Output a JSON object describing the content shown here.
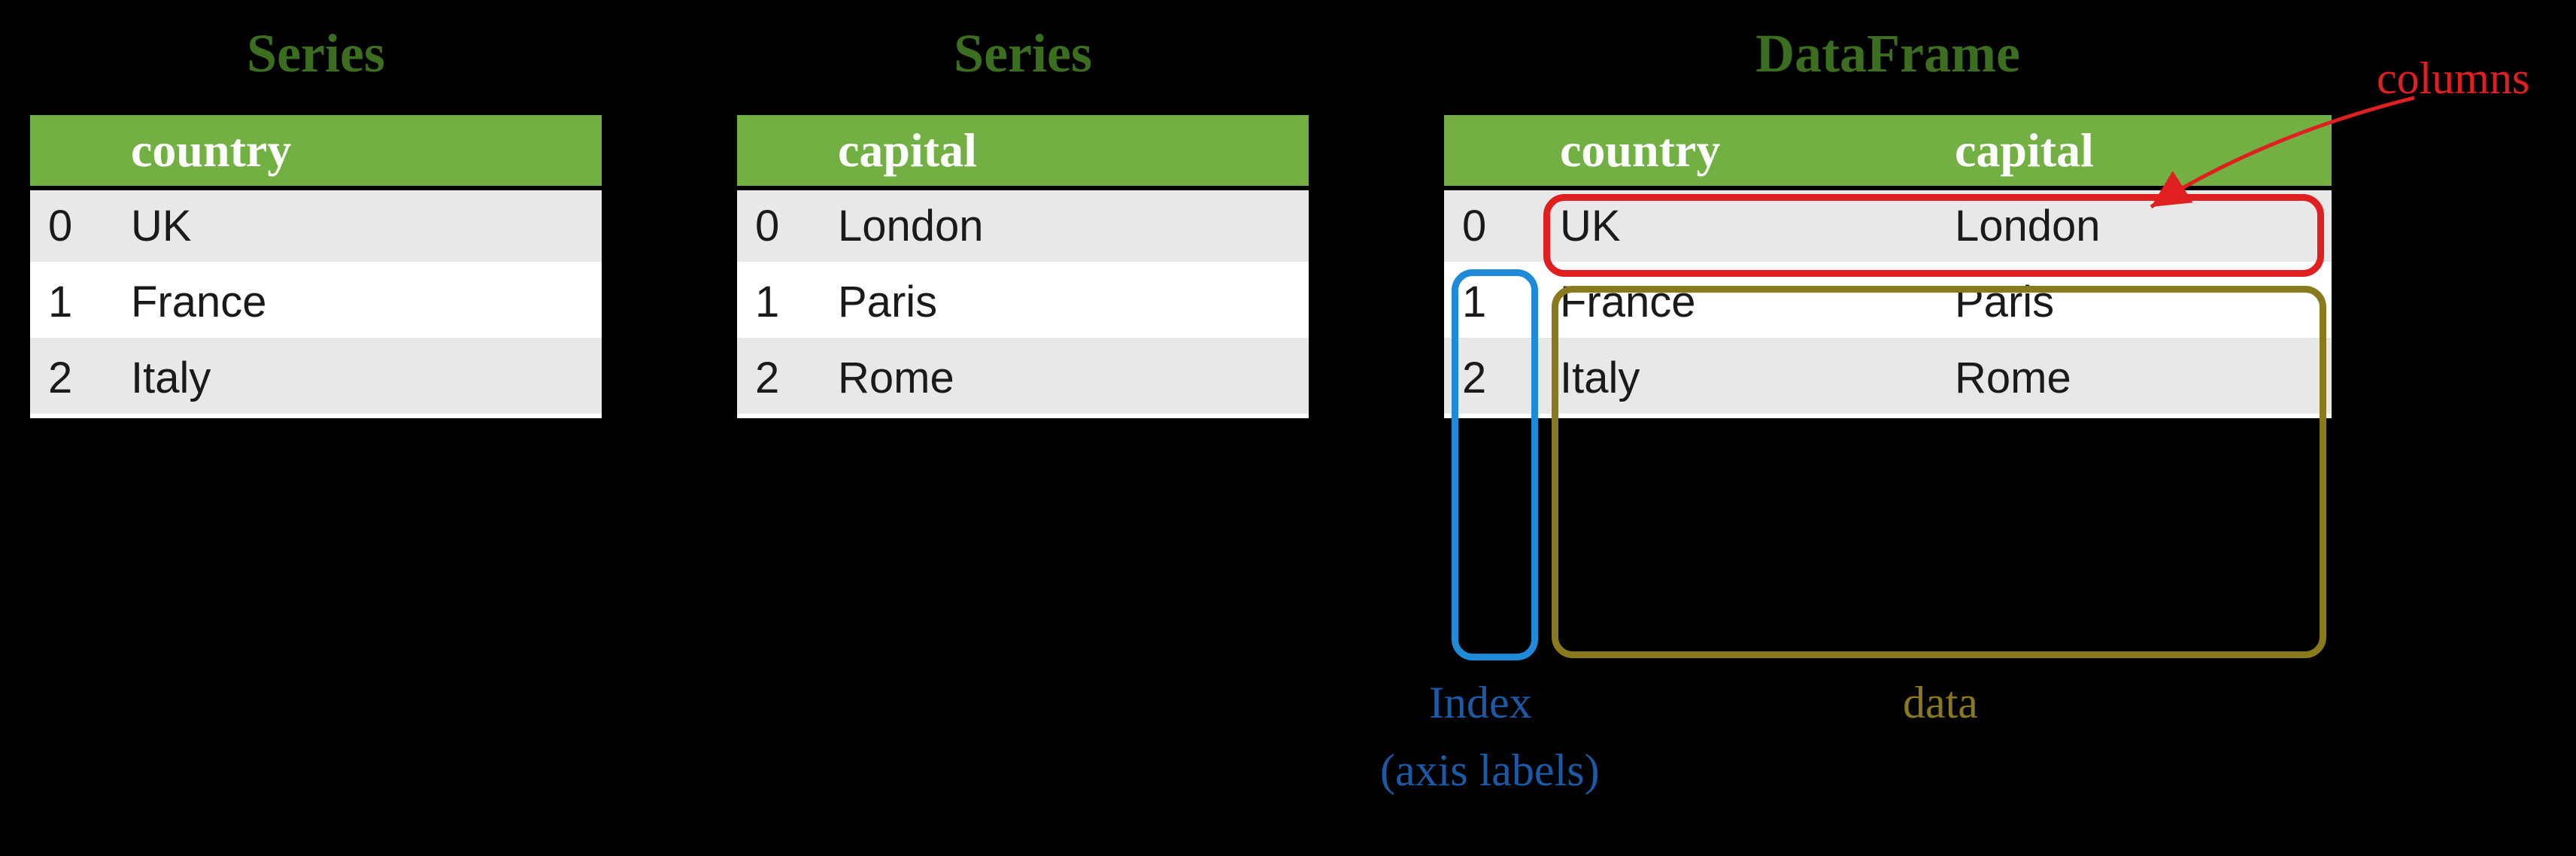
{
  "series1": {
    "title": "Series",
    "header": "country",
    "rows": [
      {
        "index": "0",
        "value": "UK"
      },
      {
        "index": "1",
        "value": "France"
      },
      {
        "index": "2",
        "value": "Italy"
      }
    ]
  },
  "series2": {
    "title": "Series",
    "header": "capital",
    "rows": [
      {
        "index": "0",
        "value": "London"
      },
      {
        "index": "1",
        "value": "Paris"
      },
      {
        "index": "2",
        "value": "Rome"
      }
    ]
  },
  "dataframe": {
    "title": "DataFrame",
    "headers": [
      "country",
      "capital"
    ],
    "rows": [
      {
        "index": "0",
        "cells": [
          "UK",
          "London"
        ]
      },
      {
        "index": "1",
        "cells": [
          "France",
          "Paris"
        ]
      },
      {
        "index": "2",
        "cells": [
          "Italy",
          "Rome"
        ]
      }
    ]
  },
  "annotations": {
    "columns": "columns",
    "index": "Index",
    "axis_labels": "(axis labels)",
    "data": "data"
  },
  "chart_data": {
    "type": "table",
    "title": "Pandas Series and DataFrame diagram",
    "series": [
      {
        "name": "country",
        "index": [
          0,
          1,
          2
        ],
        "values": [
          "UK",
          "France",
          "Italy"
        ]
      },
      {
        "name": "capital",
        "index": [
          0,
          1,
          2
        ],
        "values": [
          "London",
          "Paris",
          "Rome"
        ]
      }
    ],
    "dataframe": {
      "columns": [
        "country",
        "capital"
      ],
      "index": [
        0,
        1,
        2
      ],
      "data": [
        [
          "UK",
          "London"
        ],
        [
          "France",
          "Paris"
        ],
        [
          "Italy",
          "Rome"
        ]
      ]
    },
    "annotations": [
      "columns",
      "Index (axis labels)",
      "data"
    ]
  }
}
